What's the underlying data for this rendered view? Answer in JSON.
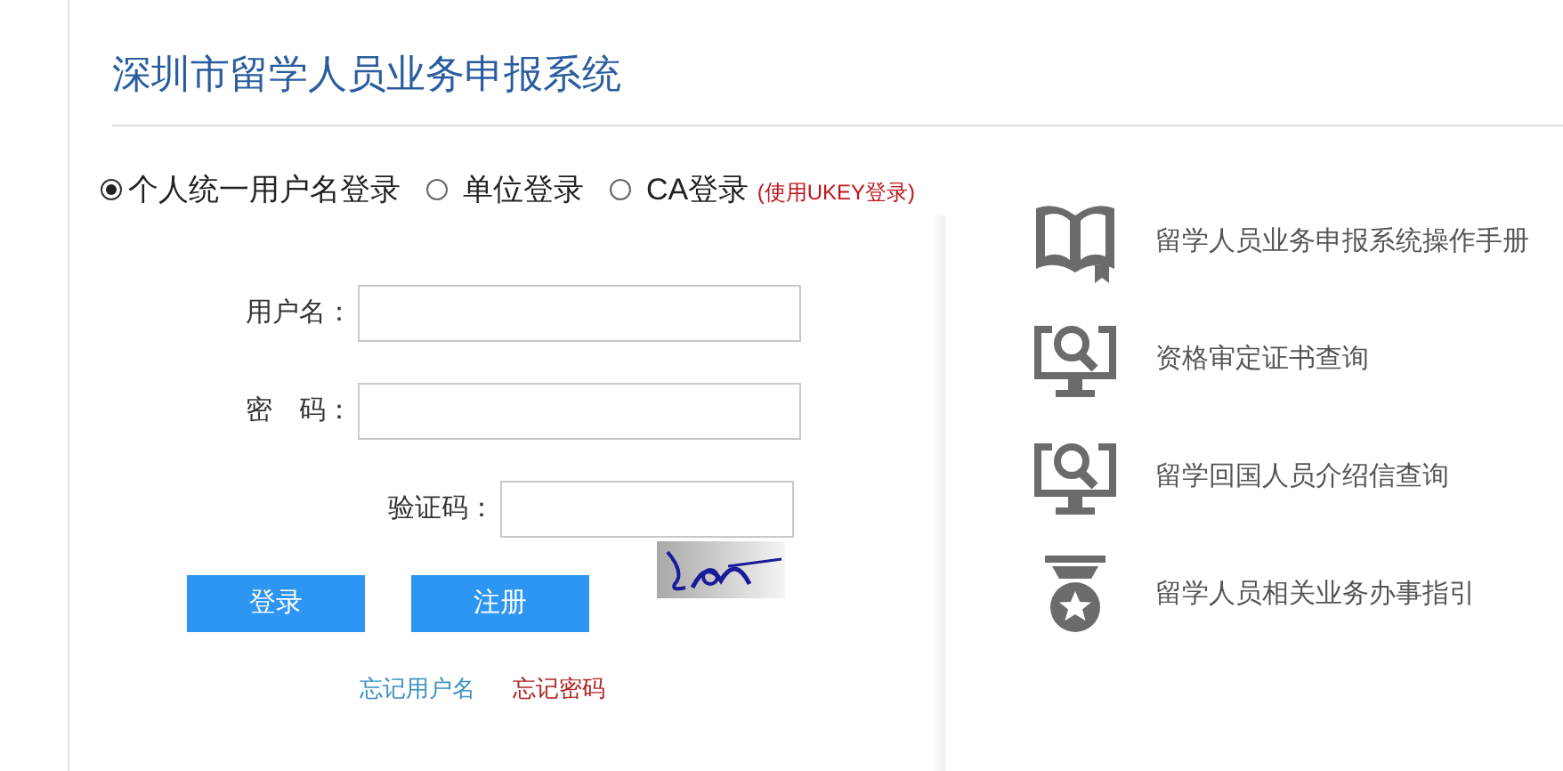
{
  "title": "深圳市留学人员业务申报系统",
  "login_types": [
    {
      "label": "个人统一用户名登录",
      "selected": true
    },
    {
      "label": "单位登录",
      "selected": false
    },
    {
      "label": "CA登录",
      "selected": false,
      "note": "(使用UKEY登录)"
    }
  ],
  "fields": [
    {
      "label": "用户名：",
      "kind": "text"
    },
    {
      "label": "密　码：",
      "kind": "password"
    },
    {
      "label": "验证码：",
      "kind": "captcha"
    }
  ],
  "buttons": [
    "登录",
    "注册"
  ],
  "links": [
    {
      "label": "忘记用户名",
      "color": "#3b8fc4"
    },
    {
      "label": "忘记密码",
      "color": "#b22222"
    }
  ],
  "services": [
    {
      "label": "留学人员业务申报系统操作手册",
      "kind": "book"
    },
    {
      "label": "资格审定证书查询",
      "kind": "monitor"
    },
    {
      "label": "留学回国人员介绍信查询",
      "kind": "monitor"
    },
    {
      "label": "留学人员相关业务办事指引",
      "kind": "medal"
    }
  ]
}
